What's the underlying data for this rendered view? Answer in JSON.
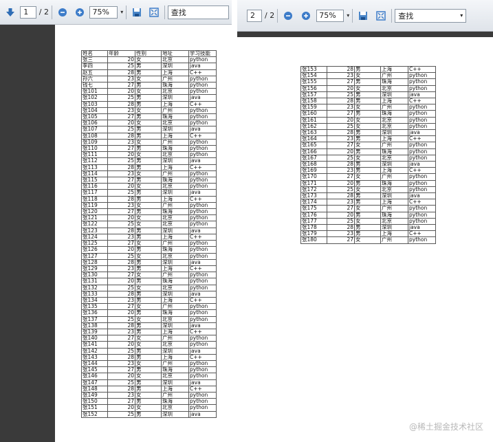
{
  "left_toolbar": {
    "page_current": "1",
    "page_total": "/ 2",
    "zoom": "75%",
    "find_label": "查找"
  },
  "right_toolbar": {
    "page_current": "2",
    "page_total": "/ 2",
    "zoom": "75%",
    "find_label": "查找"
  },
  "headers": [
    "姓名",
    "年龄",
    "性别",
    "地址",
    "学习技能"
  ],
  "rows_page1": [
    [
      "张三",
      "20",
      "女",
      "北京",
      "python"
    ],
    [
      "李四",
      "25",
      "男",
      "深圳",
      "java"
    ],
    [
      "赵五",
      "28",
      "男",
      "上海",
      "C++"
    ],
    [
      "孙六",
      "23",
      "女",
      "广州",
      "python"
    ],
    [
      "钱七",
      "27",
      "男",
      "珠海",
      "python"
    ],
    [
      "张101",
      "20",
      "女",
      "北京",
      "python"
    ],
    [
      "张102",
      "25",
      "男",
      "深圳",
      "java"
    ],
    [
      "张103",
      "28",
      "男",
      "上海",
      "C++"
    ],
    [
      "张104",
      "23",
      "女",
      "广州",
      "python"
    ],
    [
      "张105",
      "27",
      "男",
      "珠海",
      "python"
    ],
    [
      "张106",
      "20",
      "女",
      "北京",
      "python"
    ],
    [
      "张107",
      "25",
      "男",
      "深圳",
      "java"
    ],
    [
      "张108",
      "28",
      "男",
      "上海",
      "C++"
    ],
    [
      "张109",
      "23",
      "女",
      "广州",
      "python"
    ],
    [
      "张110",
      "27",
      "男",
      "珠海",
      "python"
    ],
    [
      "张111",
      "20",
      "女",
      "北京",
      "python"
    ],
    [
      "张112",
      "25",
      "男",
      "深圳",
      "java"
    ],
    [
      "张113",
      "28",
      "男",
      "上海",
      "C++"
    ],
    [
      "张114",
      "23",
      "女",
      "广州",
      "python"
    ],
    [
      "张115",
      "27",
      "男",
      "珠海",
      "python"
    ],
    [
      "张116",
      "20",
      "女",
      "北京",
      "python"
    ],
    [
      "张117",
      "25",
      "男",
      "深圳",
      "java"
    ],
    [
      "张118",
      "28",
      "男",
      "上海",
      "C++"
    ],
    [
      "张119",
      "23",
      "女",
      "广州",
      "python"
    ],
    [
      "张120",
      "27",
      "男",
      "珠海",
      "python"
    ],
    [
      "张121",
      "20",
      "女",
      "北京",
      "python"
    ],
    [
      "张122",
      "25",
      "女",
      "北京",
      "python"
    ],
    [
      "张123",
      "28",
      "男",
      "深圳",
      "java"
    ],
    [
      "张124",
      "23",
      "男",
      "上海",
      "C++"
    ],
    [
      "张125",
      "27",
      "女",
      "广州",
      "python"
    ],
    [
      "张126",
      "20",
      "男",
      "珠海",
      "python"
    ],
    [
      "张127",
      "25",
      "女",
      "北京",
      "python"
    ],
    [
      "张128",
      "28",
      "男",
      "深圳",
      "java"
    ],
    [
      "张129",
      "23",
      "男",
      "上海",
      "C++"
    ],
    [
      "张130",
      "27",
      "女",
      "广州",
      "python"
    ],
    [
      "张131",
      "20",
      "男",
      "珠海",
      "python"
    ],
    [
      "张132",
      "25",
      "女",
      "北京",
      "python"
    ],
    [
      "张133",
      "28",
      "男",
      "深圳",
      "java"
    ],
    [
      "张134",
      "23",
      "男",
      "上海",
      "C++"
    ],
    [
      "张135",
      "27",
      "女",
      "广州",
      "python"
    ],
    [
      "张136",
      "20",
      "男",
      "珠海",
      "python"
    ],
    [
      "张137",
      "25",
      "女",
      "北京",
      "python"
    ],
    [
      "张138",
      "28",
      "男",
      "深圳",
      "java"
    ],
    [
      "张139",
      "23",
      "男",
      "上海",
      "C++"
    ],
    [
      "张140",
      "27",
      "女",
      "广州",
      "python"
    ],
    [
      "张141",
      "20",
      "女",
      "北京",
      "python"
    ],
    [
      "张142",
      "25",
      "男",
      "深圳",
      "java"
    ],
    [
      "张143",
      "28",
      "男",
      "上海",
      "C++"
    ],
    [
      "张144",
      "23",
      "女",
      "广州",
      "python"
    ],
    [
      "张145",
      "27",
      "男",
      "珠海",
      "python"
    ],
    [
      "张146",
      "20",
      "女",
      "北京",
      "python"
    ],
    [
      "张147",
      "25",
      "男",
      "深圳",
      "java"
    ],
    [
      "张148",
      "28",
      "男",
      "上海",
      "C++"
    ],
    [
      "张149",
      "23",
      "女",
      "广州",
      "python"
    ],
    [
      "张150",
      "27",
      "男",
      "珠海",
      "python"
    ],
    [
      "张151",
      "20",
      "女",
      "北京",
      "python"
    ],
    [
      "张152",
      "25",
      "男",
      "深圳",
      "java"
    ]
  ],
  "rows_page2": [
    [
      "张153",
      "28",
      "男",
      "上海",
      "C++"
    ],
    [
      "张154",
      "23",
      "女",
      "广州",
      "python"
    ],
    [
      "张155",
      "27",
      "男",
      "珠海",
      "python"
    ],
    [
      "张156",
      "20",
      "女",
      "北京",
      "python"
    ],
    [
      "张157",
      "25",
      "男",
      "深圳",
      "java"
    ],
    [
      "张158",
      "28",
      "男",
      "上海",
      "C++"
    ],
    [
      "张159",
      "23",
      "女",
      "广州",
      "python"
    ],
    [
      "张160",
      "27",
      "男",
      "珠海",
      "python"
    ],
    [
      "张161",
      "20",
      "女",
      "北京",
      "python"
    ],
    [
      "张162",
      "25",
      "女",
      "北京",
      "python"
    ],
    [
      "张163",
      "28",
      "男",
      "深圳",
      "java"
    ],
    [
      "张164",
      "23",
      "男",
      "上海",
      "C++"
    ],
    [
      "张165",
      "27",
      "女",
      "广州",
      "python"
    ],
    [
      "张166",
      "20",
      "男",
      "珠海",
      "python"
    ],
    [
      "张167",
      "25",
      "女",
      "北京",
      "python"
    ],
    [
      "张168",
      "28",
      "男",
      "深圳",
      "java"
    ],
    [
      "张169",
      "23",
      "男",
      "上海",
      "C++"
    ],
    [
      "张170",
      "27",
      "女",
      "广州",
      "python"
    ],
    [
      "张171",
      "20",
      "男",
      "珠海",
      "python"
    ],
    [
      "张172",
      "25",
      "女",
      "北京",
      "python"
    ],
    [
      "张173",
      "28",
      "男",
      "深圳",
      "java"
    ],
    [
      "张174",
      "23",
      "男",
      "上海",
      "C++"
    ],
    [
      "张175",
      "27",
      "女",
      "广州",
      "python"
    ],
    [
      "张176",
      "20",
      "男",
      "珠海",
      "python"
    ],
    [
      "张177",
      "25",
      "女",
      "北京",
      "python"
    ],
    [
      "张178",
      "28",
      "男",
      "深圳",
      "java"
    ],
    [
      "张179",
      "23",
      "男",
      "上海",
      "C++"
    ],
    [
      "张180",
      "27",
      "女",
      "广州",
      "python"
    ]
  ],
  "watermark": "@稀土掘金技术社区"
}
